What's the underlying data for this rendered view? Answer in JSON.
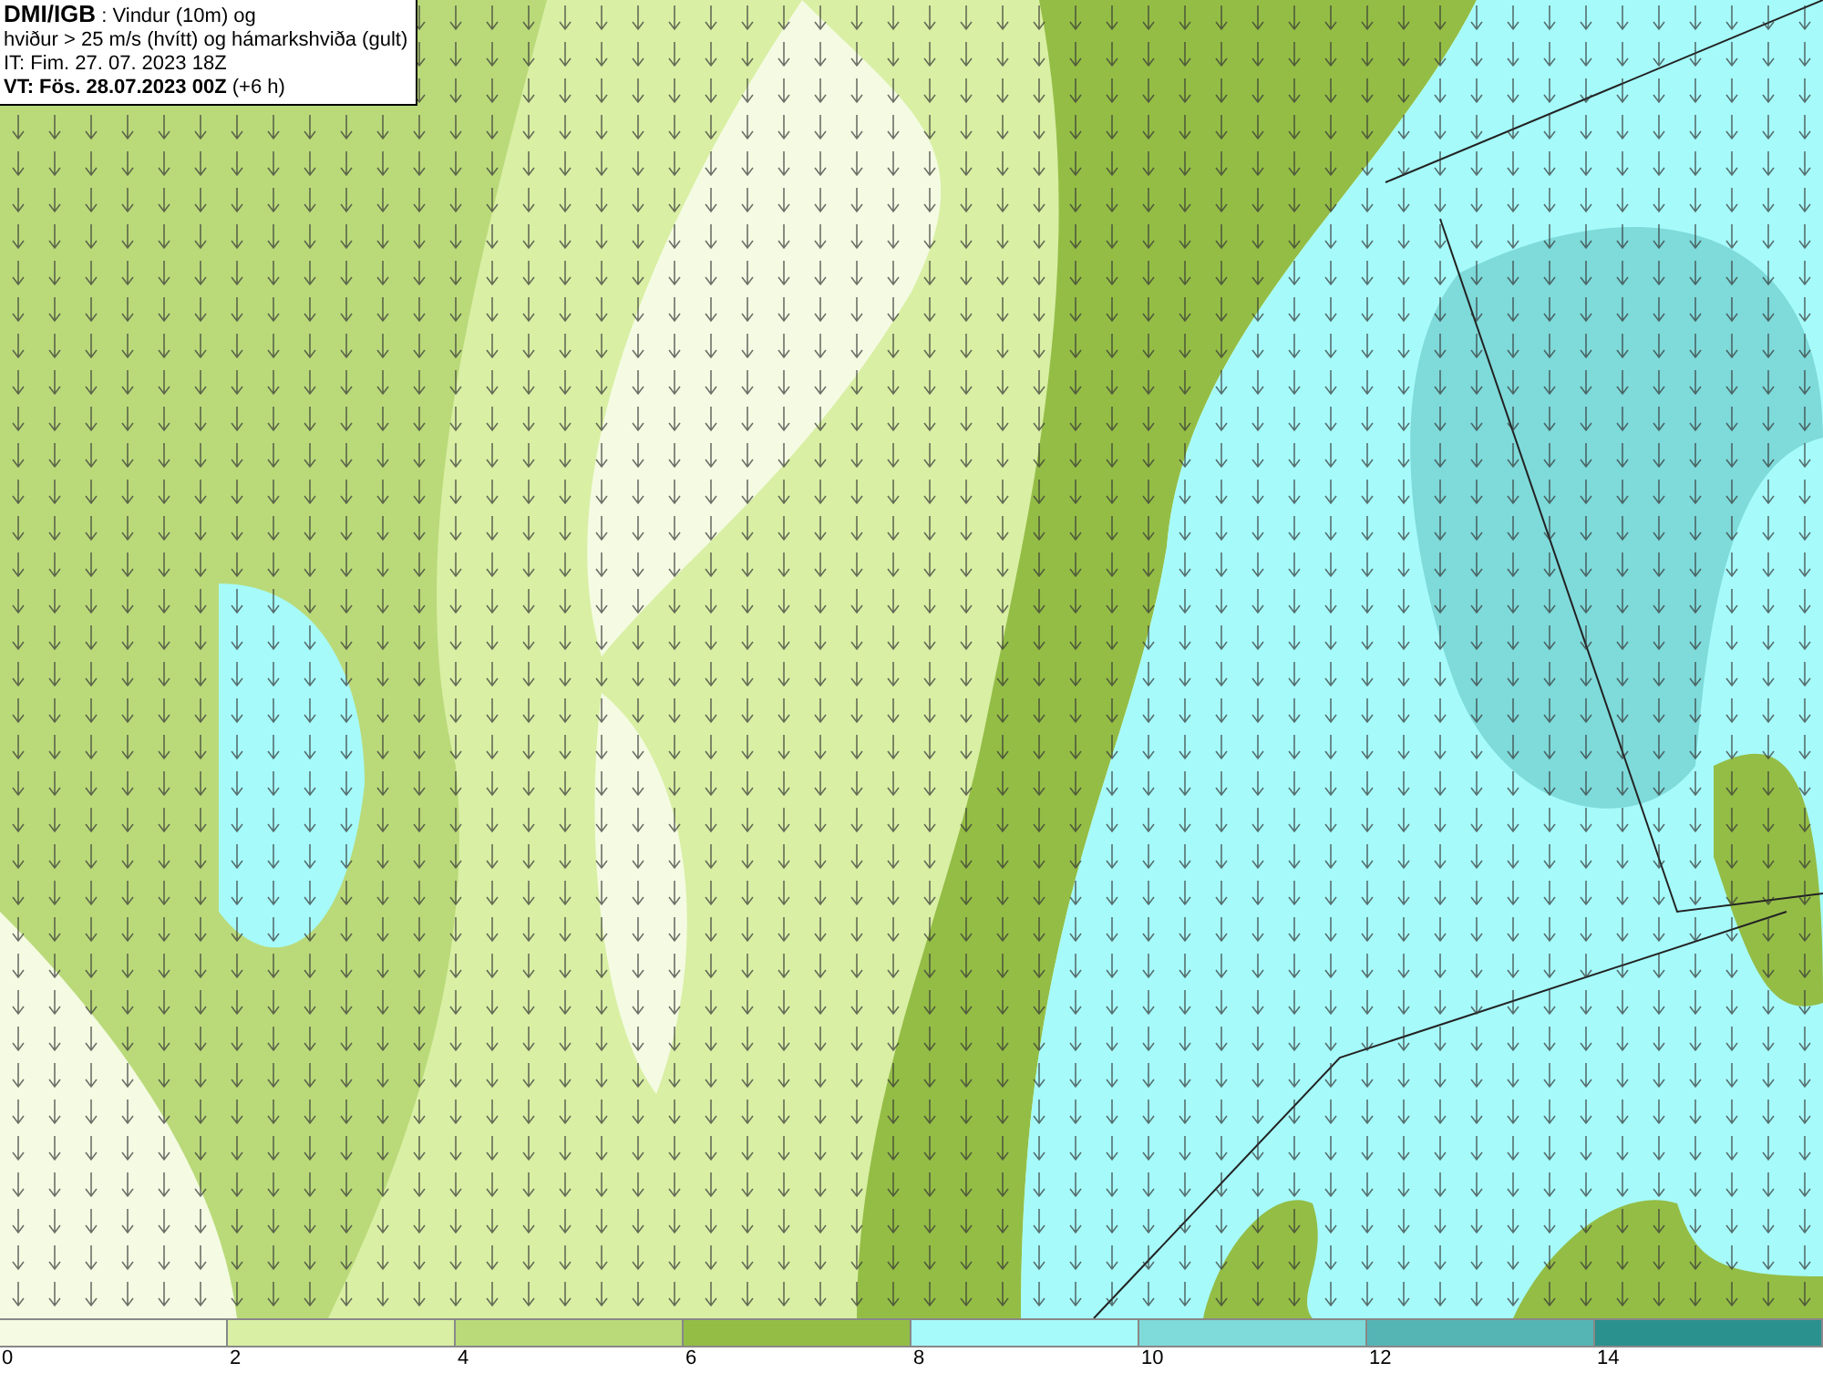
{
  "header": {
    "lines": [
      "**DMI/IGB** : Vindur (10m) og",
      "hviður > 25 m/s (hvítt) og hámarkshviða (gult)",
      "IT: Fim. 27. 07. 2023 18Z",
      "**VT: Fös. 28.07.2023 00Z** (+6 h)"
    ]
  },
  "legend": [
    {
      "label": "0",
      "color": "#f4fbe2"
    },
    {
      "label": "2",
      "color": "#d9efa4"
    },
    {
      "label": "4",
      "color": "#bada7a"
    },
    {
      "label": "6",
      "color": "#94bd46"
    },
    {
      "label": "8",
      "color": "#a6fafa"
    },
    {
      "label": "10",
      "color": "#7fdada"
    },
    {
      "label": "12",
      "color": "#55b5b5"
    },
    {
      "label": "14",
      "color": "#2a918e"
    }
  ]
}
